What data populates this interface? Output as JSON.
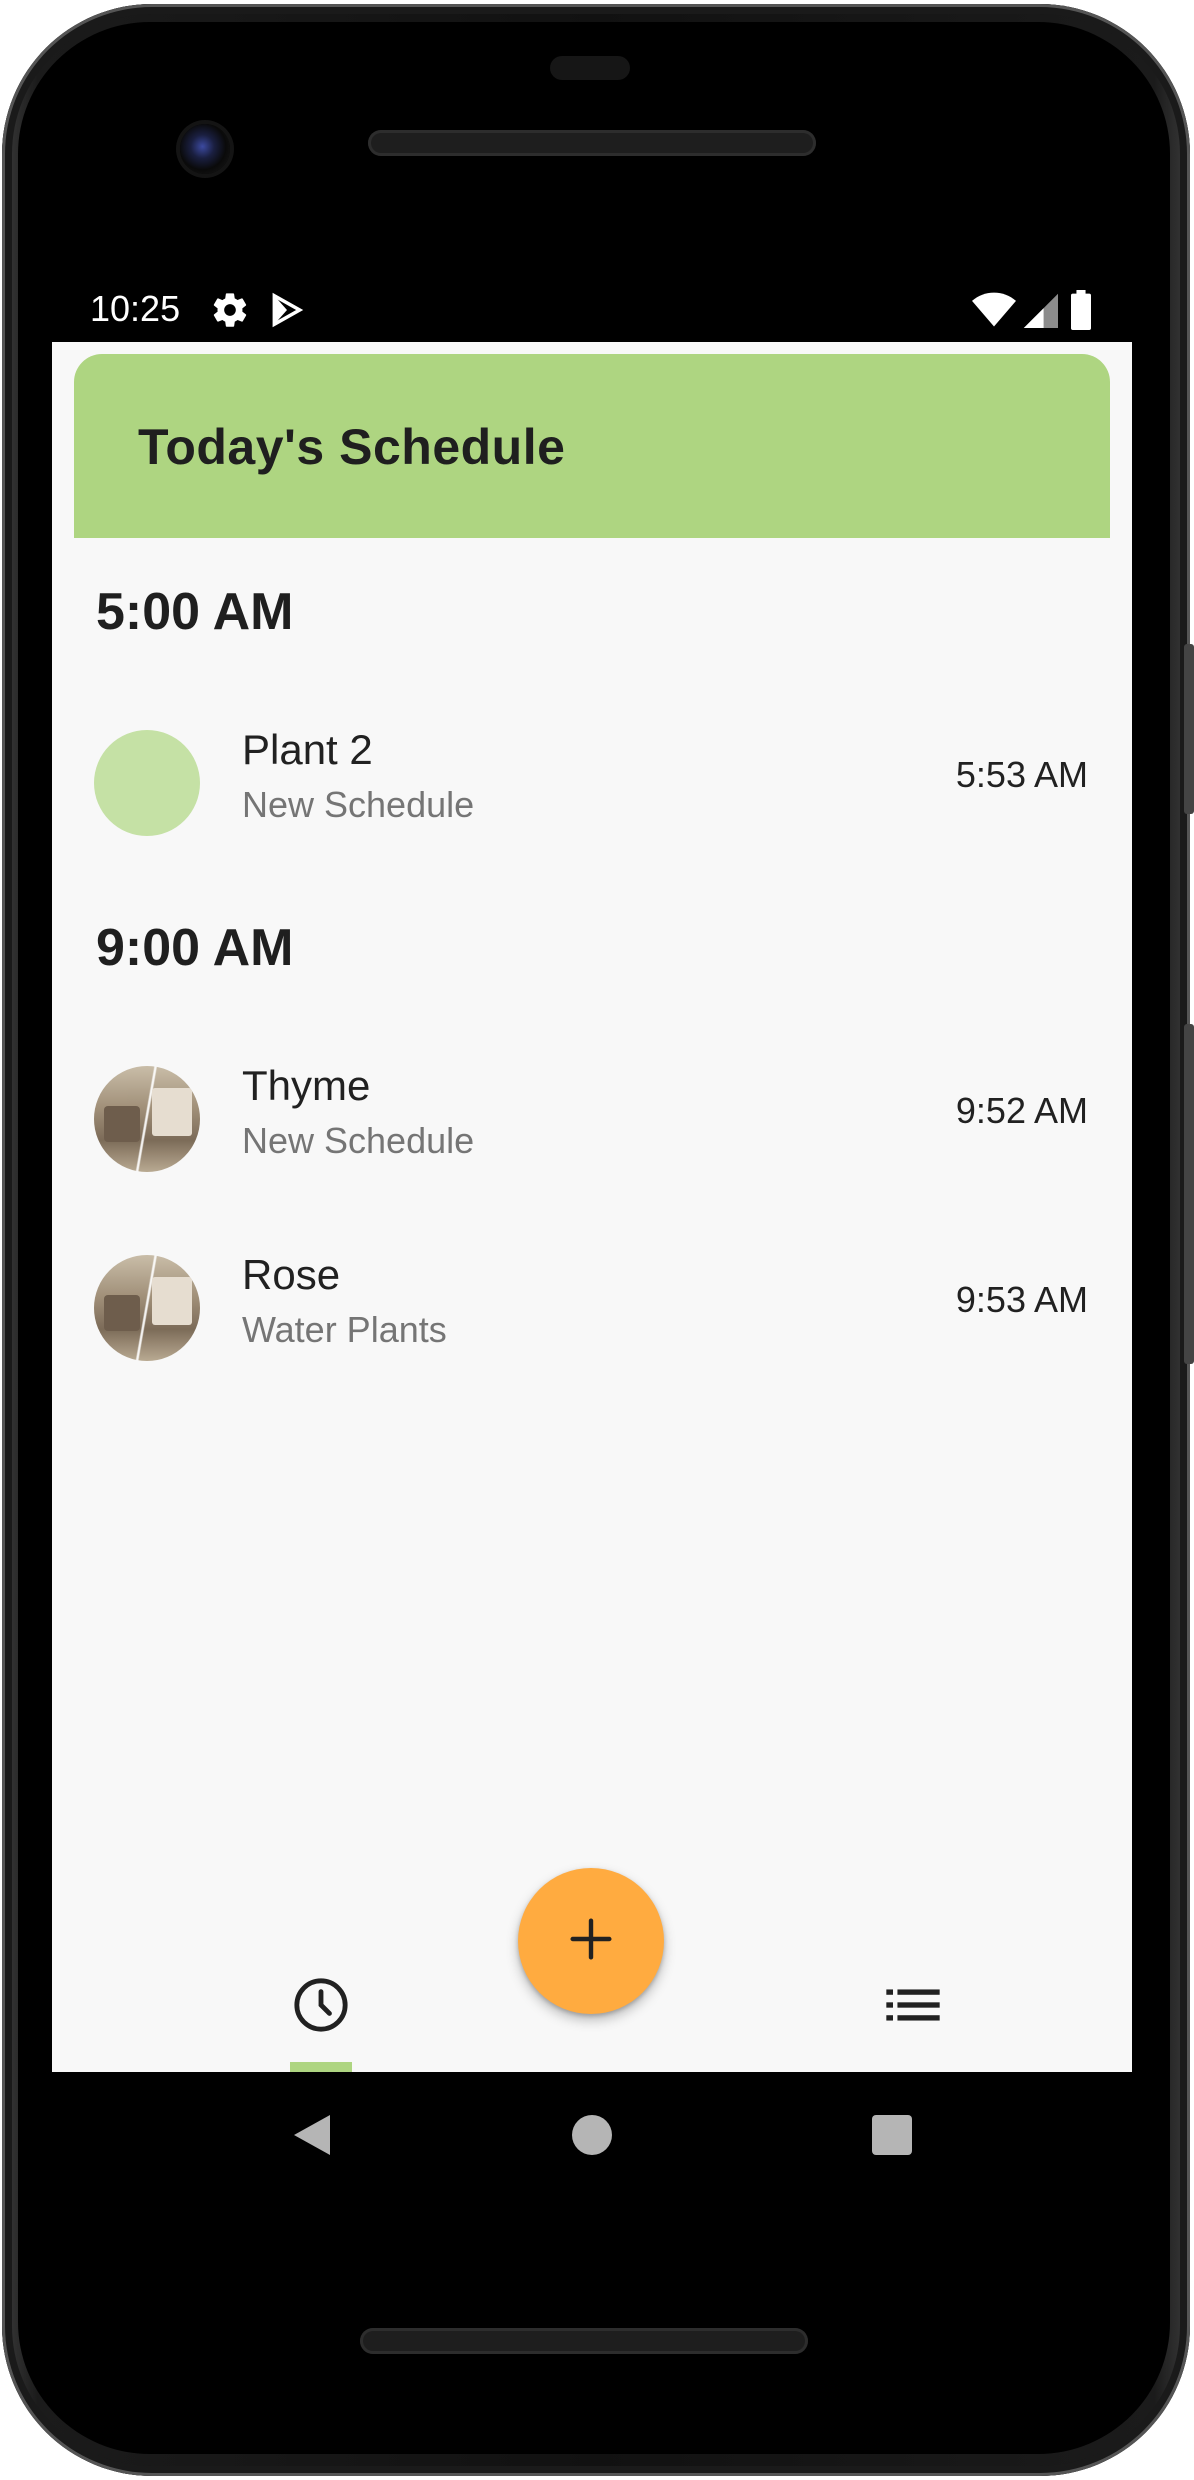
{
  "status_bar": {
    "time": "10:25",
    "icons": [
      "settings-icon",
      "play-store-icon",
      "wifi-icon",
      "cellular-signal-icon",
      "battery-icon"
    ]
  },
  "header": {
    "title": "Today's Schedule",
    "color": "#aed581"
  },
  "sections": [
    {
      "label": "5:00 AM",
      "items": [
        {
          "name": "Plant 2",
          "subtitle": "New Schedule",
          "time": "5:53 AM",
          "avatar": "plain"
        }
      ]
    },
    {
      "label": "9:00 AM",
      "items": [
        {
          "name": "Thyme",
          "subtitle": "New Schedule",
          "time": "9:52 AM",
          "avatar": "photo"
        },
        {
          "name": "Rose",
          "subtitle": "Water Plants",
          "time": "9:53 AM",
          "avatar": "photo"
        }
      ]
    }
  ],
  "fab": {
    "icon": "plus-icon",
    "color": "#ffab40"
  },
  "bottom_nav": {
    "items": [
      {
        "icon": "clock-icon",
        "selected": true
      },
      {
        "icon": "list-icon",
        "selected": false
      }
    ]
  },
  "system_nav": {
    "buttons": [
      "back-icon",
      "home-icon",
      "recents-icon"
    ]
  }
}
